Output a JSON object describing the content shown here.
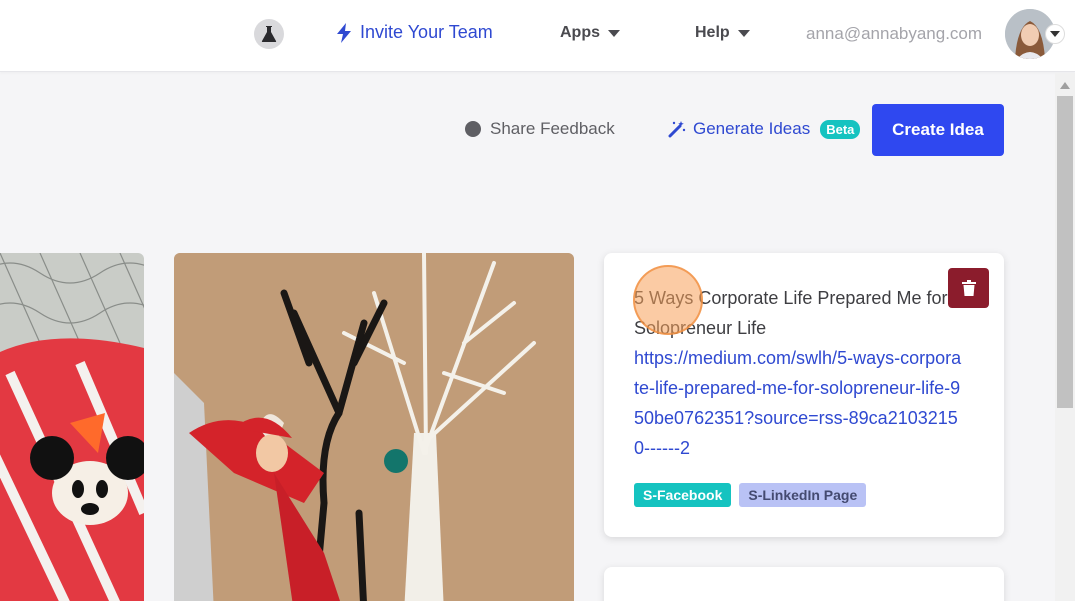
{
  "header": {
    "invite_label": "Invite Your Team",
    "apps_label": "Apps",
    "help_label": "Help",
    "user_email": "anna@annabyang.com"
  },
  "actions": {
    "share_feedback": "Share Feedback",
    "generate_ideas": "Generate Ideas",
    "beta_badge": "Beta",
    "create_idea": "Create Idea"
  },
  "idea": {
    "title": "5 Ways Corporate Life Prepared Me for Solopreneur Life",
    "link": "https://medium.com/swlh/5-ways-corporate-life-prepared-me-for-solopreneur-life-950be0762351?source=rss-89ca21032150------2",
    "tags": [
      "S-Facebook",
      "S-LinkedIn Page"
    ]
  },
  "colors": {
    "accent_blue": "#2f49d1",
    "create_button": "#2f48f0",
    "teal": "#15c3c0",
    "delete_red": "#8b1c2c",
    "tag_lavender": "#b9c2f5"
  },
  "icons": {
    "lab": "flask-icon",
    "invite": "lightning-icon",
    "share": "chat-bubble-icon",
    "generate": "magic-wand-icon",
    "delete": "trash-icon"
  }
}
